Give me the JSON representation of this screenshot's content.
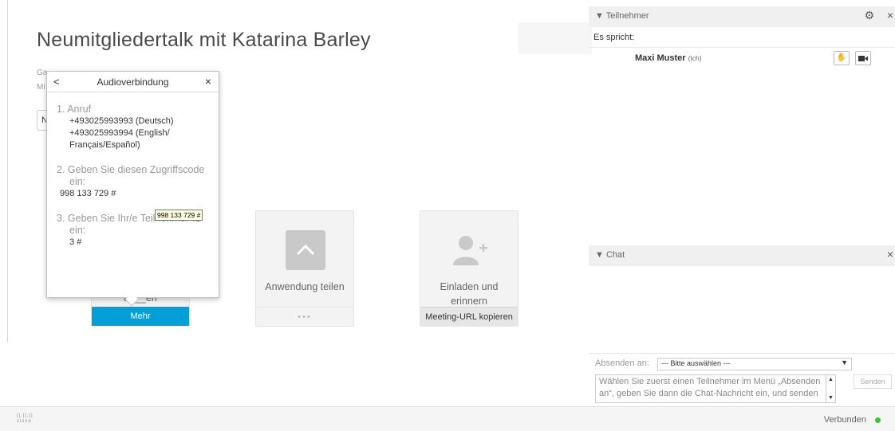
{
  "meeting": {
    "title": "Neumitgliedertalk mit Katarina Barley",
    "info_line_1": "Ga",
    "info_line_2": "Mi",
    "button_prefix": "N"
  },
  "cards": {
    "audio": {
      "label": "an__en",
      "footer": "Mehr"
    },
    "share": {
      "label": "Anwendung teilen",
      "footer": "•••"
    },
    "invite": {
      "label_1": "Einladen und",
      "label_2": "erinnern",
      "footer": "Meeting-URL kopieren"
    }
  },
  "audio_popover": {
    "back": "<",
    "title": "Audioverbindung",
    "close": "×",
    "step1_heading": "1. Anruf",
    "step1_line1": "+493025993993 (Deutsch)",
    "step1_line2": "+493025993994 (English/",
    "step1_line3": "Français/Español)",
    "step2_heading_1": "2. Geben Sie diesen Zugriffscode",
    "step2_heading_2": "ein:",
    "step2_code": "998 133 729 #",
    "tooltip": "998 133 729 #",
    "step3_heading_1": "3. Geben Sie Ihr/e Teilnehmer-ID",
    "step3_heading_2": "ein:",
    "step3_id": "3 #"
  },
  "participants": {
    "header": "Teilnehmer",
    "speaking": "Es spricht:",
    "name": "Maxi Muster",
    "tag": "(Ich)"
  },
  "chat": {
    "header": "Chat",
    "send_to_label": "Absenden an:",
    "recipient_selected": "--- Bitte auswählen ---",
    "input_placeholder": "Wählen Sie zuerst einen Teilnehmer im Menü „Absenden an“, geben Sie dann die Chat-Nachricht ein, und senden",
    "send_button": "Senden"
  },
  "status": {
    "logo": "cisco",
    "connection": "Verbunden",
    "connection_color": "#32c832"
  },
  "colors": {
    "accent": "#049fd9",
    "title_text": "#4a4a4a"
  }
}
